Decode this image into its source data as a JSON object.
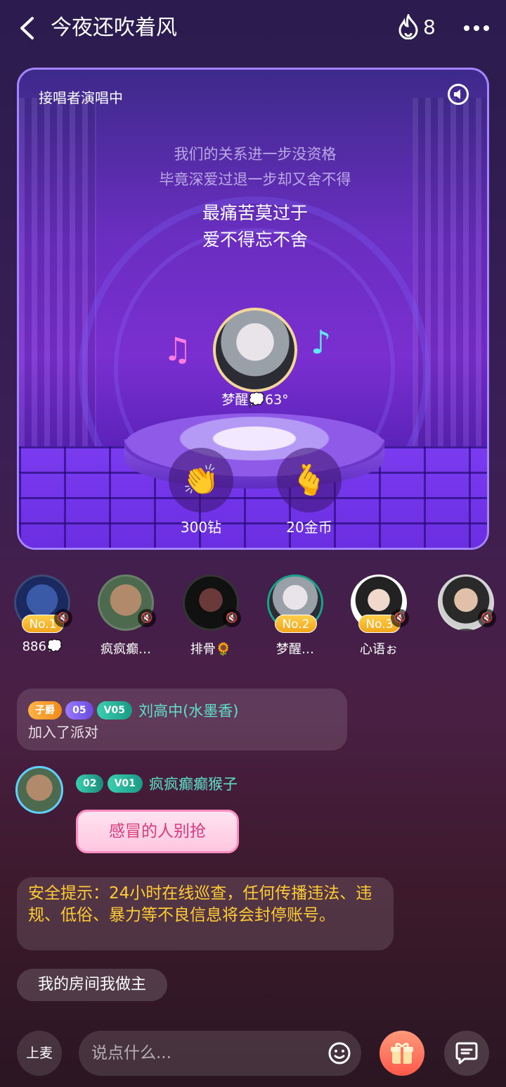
{
  "header": {
    "title": "今夜还吹着风",
    "hot_count": "8"
  },
  "stage": {
    "label": "接唱者演唱中",
    "lyrics_prev": [
      "我们的关系进一步没资格",
      "毕竟深爱过退一步却又舍不得"
    ],
    "lyrics_current": [
      "最痛苦莫过于",
      "爱不得忘不舍"
    ],
    "singer_name": "梦醒💭63°",
    "reactions": [
      {
        "icon": "👏",
        "label": "300钻"
      },
      {
        "icon": "🫰",
        "label": "20金币"
      }
    ]
  },
  "mic_seats": [
    {
      "name": "886💭",
      "rank": "No.1"
    },
    {
      "name": "疯疯癫…",
      "rank": ""
    },
    {
      "name": "排骨🌻",
      "rank": ""
    },
    {
      "name": "梦醒…",
      "rank": "No.2"
    },
    {
      "name": "心语ぉ",
      "rank": "No.3"
    },
    {
      "name": "",
      "rank": ""
    }
  ],
  "messages": {
    "join": {
      "badges": [
        "子爵",
        "05",
        "V05"
      ],
      "user": "刘高中(水墨香)",
      "text": "加入了派对"
    },
    "chat": {
      "badges": [
        "02",
        "V01"
      ],
      "user": "疯疯癫癫猴子",
      "text": "感冒的人别抢"
    },
    "safety": "安全提示：24小时在线巡查，任何传播违法、违规、低俗、暴力等不良信息将会封停账号。",
    "owner": "我的房间我做主"
  },
  "bottom": {
    "mic_label": "上麦",
    "input_placeholder": "说点什么..."
  },
  "colors": {
    "accent": "#a385ff",
    "username": "#5fe0c8",
    "warning": "#ffcc33",
    "rank_badge": "#f3a51a"
  }
}
